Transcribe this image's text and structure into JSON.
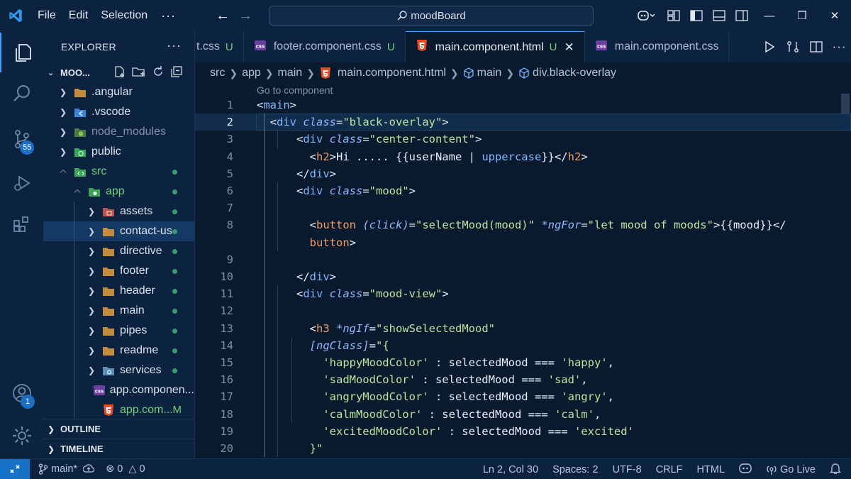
{
  "titlebar": {
    "menu": [
      "File",
      "Edit",
      "Selection"
    ],
    "more": "···",
    "search_text": "moodBoard"
  },
  "activitybar": {
    "items": [
      "explorer-icon",
      "search-icon",
      "source-control-icon",
      "run-debug-icon",
      "extensions-icon"
    ],
    "source_control_badge": "55",
    "accounts_badge": "1"
  },
  "sidebar": {
    "title": "EXPLORER",
    "more": "···",
    "root_label": "MOO...",
    "tree": [
      {
        "label": ".angular",
        "indent": 0,
        "twisty": "right",
        "icon": "folder",
        "state": ""
      },
      {
        "label": ".vscode",
        "indent": 0,
        "twisty": "right",
        "icon": "folder-vscode",
        "state": ""
      },
      {
        "label": "node_modules",
        "indent": 0,
        "twisty": "right",
        "icon": "folder-node",
        "state": "dim"
      },
      {
        "label": "public",
        "indent": 0,
        "twisty": "right",
        "icon": "folder-public",
        "state": ""
      },
      {
        "label": "src",
        "indent": 0,
        "twisty": "down",
        "icon": "folder-src",
        "state": "green",
        "dot": true
      },
      {
        "label": "app",
        "indent": 1,
        "twisty": "down",
        "icon": "folder-app",
        "state": "green",
        "dot": true
      },
      {
        "label": "assets",
        "indent": 2,
        "twisty": "right",
        "icon": "folder-assets",
        "state": "",
        "dot": true
      },
      {
        "label": "contact-us",
        "indent": 2,
        "twisty": "right",
        "icon": "folder",
        "state": "",
        "dot": true,
        "selected": true
      },
      {
        "label": "directive",
        "indent": 2,
        "twisty": "right",
        "icon": "folder",
        "state": "",
        "dot": true
      },
      {
        "label": "footer",
        "indent": 2,
        "twisty": "right",
        "icon": "folder",
        "state": "",
        "dot": true
      },
      {
        "label": "header",
        "indent": 2,
        "twisty": "right",
        "icon": "folder",
        "state": "",
        "dot": true
      },
      {
        "label": "main",
        "indent": 2,
        "twisty": "right",
        "icon": "folder",
        "state": "",
        "dot": true
      },
      {
        "label": "pipes",
        "indent": 2,
        "twisty": "right",
        "icon": "folder",
        "state": "",
        "dot": true
      },
      {
        "label": "readme",
        "indent": 2,
        "twisty": "right",
        "icon": "folder",
        "state": "",
        "dot": true
      },
      {
        "label": "services",
        "indent": 2,
        "twisty": "right",
        "icon": "folder-services",
        "state": "",
        "dot": true
      },
      {
        "label": "app.componen...",
        "indent": 2,
        "twisty": "none",
        "icon": "css",
        "state": ""
      },
      {
        "label": "app.com...",
        "indent": 2,
        "twisty": "none",
        "icon": "html",
        "state": "green",
        "mod": "M"
      }
    ],
    "outline": "OUTLINE",
    "timeline": "TIMELINE"
  },
  "tabs": [
    {
      "label": "t.css",
      "badge": "U",
      "icon": "none",
      "active": false
    },
    {
      "label": "footer.component.css",
      "badge": "U",
      "icon": "css",
      "active": false
    },
    {
      "label": "main.component.html",
      "badge": "U",
      "icon": "html",
      "active": true
    },
    {
      "label": "main.component.css",
      "badge": "",
      "icon": "css",
      "active": false
    }
  ],
  "breadcrumb": {
    "items": [
      "src",
      "app",
      "main",
      "main.component.html",
      "main",
      "div.black-overlay"
    ]
  },
  "editor": {
    "codelens": "Go to component",
    "current_line": 2,
    "lines": [
      {
        "n": "1",
        "code": [
          [
            "pl",
            "<"
          ],
          [
            "tg",
            "main"
          ],
          [
            "pl",
            ">"
          ]
        ]
      },
      {
        "n": "2",
        "code": [
          [
            "pl",
            "  <"
          ],
          [
            "tg",
            "div "
          ],
          [
            "at",
            "class"
          ],
          [
            "pl",
            "="
          ],
          [
            "st",
            "\"black-overlay\""
          ],
          [
            "pl",
            ">"
          ]
        ]
      },
      {
        "n": "3",
        "code": [
          [
            "pl",
            "      <"
          ],
          [
            "tg",
            "div "
          ],
          [
            "at",
            "class"
          ],
          [
            "pl",
            "="
          ],
          [
            "st",
            "\"center-content\""
          ],
          [
            "pl",
            ">"
          ]
        ]
      },
      {
        "n": "4",
        "code": [
          [
            "pl",
            "        <"
          ],
          [
            "tg2",
            "h2"
          ],
          [
            "pl",
            ">Hi ..... {{userName | "
          ],
          [
            "tg",
            "uppercase"
          ],
          [
            "pl",
            "}}</"
          ],
          [
            "tg2",
            "h2"
          ],
          [
            "pl",
            ">"
          ]
        ]
      },
      {
        "n": "5",
        "code": [
          [
            "pl",
            "      </"
          ],
          [
            "tg",
            "div"
          ],
          [
            "pl",
            ">"
          ]
        ]
      },
      {
        "n": "6",
        "code": [
          [
            "pl",
            "      <"
          ],
          [
            "tg",
            "div "
          ],
          [
            "at",
            "class"
          ],
          [
            "pl",
            "="
          ],
          [
            "st",
            "\"mood\""
          ],
          [
            "pl",
            ">"
          ]
        ]
      },
      {
        "n": "7",
        "code": []
      },
      {
        "n": "8",
        "code": [
          [
            "pl",
            "        <"
          ],
          [
            "tg2",
            "button "
          ],
          [
            "at",
            "(click)"
          ],
          [
            "pl",
            "="
          ],
          [
            "st",
            "\"selectMood(mood)\" "
          ],
          [
            "at",
            "*ngFor"
          ],
          [
            "pl",
            "="
          ],
          [
            "st",
            "\"let mood of moods\""
          ],
          [
            "pl",
            ">{{mood}}</"
          ]
        ]
      },
      {
        "n": "",
        "code": [
          [
            "tg2",
            "        button"
          ],
          [
            "pl",
            ">"
          ]
        ]
      },
      {
        "n": "9",
        "code": []
      },
      {
        "n": "10",
        "code": [
          [
            "pl",
            "      </"
          ],
          [
            "tg",
            "div"
          ],
          [
            "pl",
            ">"
          ]
        ]
      },
      {
        "n": "11",
        "code": [
          [
            "pl",
            "      <"
          ],
          [
            "tg",
            "div "
          ],
          [
            "at",
            "class"
          ],
          [
            "pl",
            "="
          ],
          [
            "st",
            "\"mood-view\""
          ],
          [
            "pl",
            ">"
          ]
        ]
      },
      {
        "n": "12",
        "code": []
      },
      {
        "n": "13",
        "code": [
          [
            "pl",
            "        <"
          ],
          [
            "tg2",
            "h3 "
          ],
          [
            "at",
            "*ngIf"
          ],
          [
            "pl",
            "="
          ],
          [
            "st",
            "\"showSelectedMood\""
          ]
        ]
      },
      {
        "n": "14",
        "code": [
          [
            "at",
            "        [ngClass]"
          ],
          [
            "pl",
            "="
          ],
          [
            "st",
            "\"{"
          ]
        ]
      },
      {
        "n": "15",
        "code": [
          [
            "st",
            "          'happyMoodColor'"
          ],
          [
            "pl",
            " : selectedMood === "
          ],
          [
            "st",
            "'happy'"
          ],
          [
            "pl",
            ","
          ]
        ]
      },
      {
        "n": "16",
        "code": [
          [
            "st",
            "          'sadMoodColor'"
          ],
          [
            "pl",
            " : selectedMood === "
          ],
          [
            "st",
            "'sad'"
          ],
          [
            "pl",
            ","
          ]
        ]
      },
      {
        "n": "17",
        "code": [
          [
            "st",
            "          'angryMoodColor'"
          ],
          [
            "pl",
            " : selectedMood === "
          ],
          [
            "st",
            "'angry'"
          ],
          [
            "pl",
            ","
          ]
        ]
      },
      {
        "n": "18",
        "code": [
          [
            "st",
            "          'calmMoodColor'"
          ],
          [
            "pl",
            " : selectedMood === "
          ],
          [
            "st",
            "'calm'"
          ],
          [
            "pl",
            ","
          ]
        ]
      },
      {
        "n": "19",
        "code": [
          [
            "st",
            "          'excitedMoodColor'"
          ],
          [
            "pl",
            " : selectedMood === "
          ],
          [
            "st",
            "'excited'"
          ]
        ]
      },
      {
        "n": "20",
        "code": [
          [
            "st",
            "        }\""
          ]
        ]
      }
    ]
  },
  "statusbar": {
    "branch": "main*",
    "errors": "0",
    "warnings": "0",
    "position": "Ln 2, Col 30",
    "spaces": "Spaces: 2",
    "encoding": "UTF-8",
    "eol": "CRLF",
    "language": "HTML",
    "golive": "Go Live"
  },
  "colors": {
    "accent": "#3aa0ff",
    "tag": "#7fb8ff",
    "tag_alt": "#f29b63",
    "attribute": "#8fb7ff",
    "string": "#b8e6a0",
    "untracked": "#6ccf74"
  }
}
